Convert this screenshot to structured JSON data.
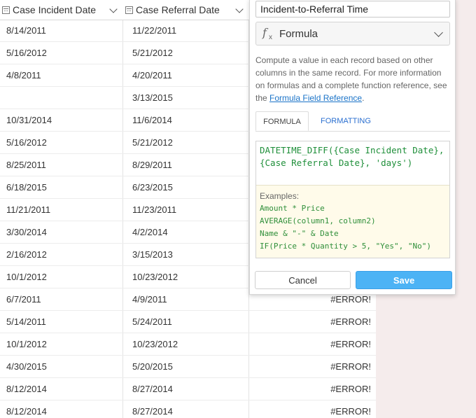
{
  "grid": {
    "columns": [
      {
        "label": "Case Incident Date"
      },
      {
        "label": "Case Referral Date"
      }
    ],
    "rows": [
      {
        "incident": "8/14/2011",
        "referral": "11/22/2011",
        "result": ""
      },
      {
        "incident": "5/16/2012",
        "referral": "5/21/2012",
        "result": ""
      },
      {
        "incident": "4/8/2011",
        "referral": "4/20/2011",
        "result": ""
      },
      {
        "incident": "",
        "referral": "3/13/2015",
        "result": ""
      },
      {
        "incident": "10/31/2014",
        "referral": "11/6/2014",
        "result": ""
      },
      {
        "incident": "5/16/2012",
        "referral": "5/21/2012",
        "result": ""
      },
      {
        "incident": "8/25/2011",
        "referral": "8/29/2011",
        "result": ""
      },
      {
        "incident": "6/18/2015",
        "referral": "6/23/2015",
        "result": ""
      },
      {
        "incident": "11/21/2011",
        "referral": "11/23/2011",
        "result": ""
      },
      {
        "incident": "3/30/2014",
        "referral": "4/2/2014",
        "result": ""
      },
      {
        "incident": "2/16/2012",
        "referral": "3/15/2013",
        "result": ""
      },
      {
        "incident": "10/1/2012",
        "referral": "10/23/2012",
        "result": ""
      },
      {
        "incident": "6/7/2011",
        "referral": "4/9/2011",
        "result": "#ERROR!"
      },
      {
        "incident": "5/14/2011",
        "referral": "5/24/2011",
        "result": "#ERROR!"
      },
      {
        "incident": "10/1/2012",
        "referral": "10/23/2012",
        "result": "#ERROR!"
      },
      {
        "incident": "4/30/2015",
        "referral": "5/20/2015",
        "result": "#ERROR!"
      },
      {
        "incident": "8/12/2014",
        "referral": "8/27/2014",
        "result": "#ERROR!"
      },
      {
        "incident": "8/12/2014",
        "referral": "8/27/2014",
        "result": "#ERROR!"
      }
    ]
  },
  "panel": {
    "field_name": "Incident-to-Referral Time",
    "field_type": "Formula",
    "description": "Compute a value in each record based on other columns in the same record. For more information on formulas and a complete function reference, see the ",
    "description_link": "Formula Field Reference",
    "description_end": ".",
    "tabs": {
      "formula": "FORMULA",
      "formatting": "FORMATTING"
    },
    "formula": "DATETIME_DIFF({Case Incident Date}, {Case Referral Date}, 'days')",
    "examples_title": "Examples:",
    "examples": [
      "Amount * Price",
      "AVERAGE(column1, column2)",
      "Name & \"-\" & Date",
      "IF(Price * Quantity > 5, \"Yes\", \"No\")"
    ],
    "cancel_label": "Cancel",
    "save_label": "Save"
  }
}
